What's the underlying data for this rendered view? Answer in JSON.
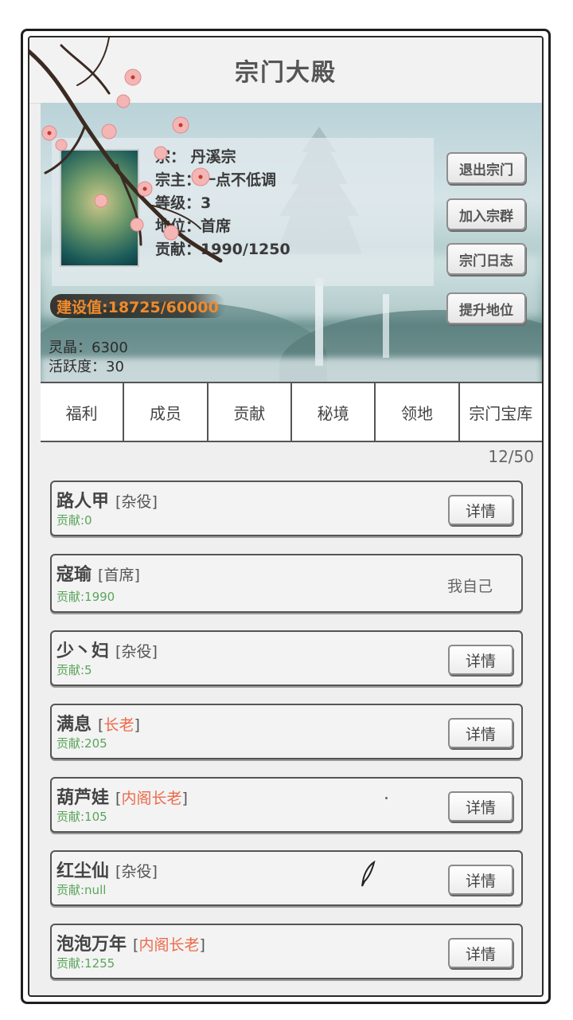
{
  "header": {
    "title": "宗门大殿"
  },
  "sect_info": {
    "name_line": "宗：  丹溪宗",
    "master_line": "宗主：一点不低调",
    "level_line": "等级：3",
    "position_line": "地位：首席",
    "contribution_line": "贡献：1990/1250",
    "construction": "建设值:18725/60000",
    "spirit_crystal": "灵晶：6300",
    "activity": "活跃度：30"
  },
  "actions": {
    "leave": "退出宗门",
    "join_group": "加入宗群",
    "log": "宗门日志",
    "promote": "提升地位"
  },
  "tabs": [
    "福利",
    "成员",
    "贡献",
    "秘境",
    "领地",
    "宗门宝库"
  ],
  "member_count": "12/50",
  "members": [
    {
      "name": "路人甲",
      "rank_open": "[",
      "rank": "杂役",
      "rank_close": "]",
      "contrib": "贡献:0",
      "action": "详情"
    },
    {
      "name": "寇瑜",
      "rank_open": "[",
      "rank": "首席",
      "rank_close": "]",
      "contrib": "贡献:1990",
      "action": "我自己"
    },
    {
      "name": "少丶妇",
      "rank_open": "[",
      "rank": "杂役",
      "rank_close": "]",
      "contrib": "贡献:5",
      "action": "详情"
    },
    {
      "name": "满息",
      "rank_open": "[",
      "rank": "长老",
      "rank_close": "]",
      "contrib": "贡献:205",
      "action": "详情"
    },
    {
      "name": "葫芦娃",
      "rank_open": "[",
      "rank": "内阁长老",
      "rank_close": "]",
      "contrib": "贡献:105",
      "action": "详情"
    },
    {
      "name": "红尘仙",
      "rank_open": "[",
      "rank": "杂役",
      "rank_close": "]",
      "contrib": "贡献:null",
      "action": "详情"
    },
    {
      "name": "泡泡万年",
      "rank_open": "[",
      "rank": "内阁长老",
      "rank_close": "]",
      "contrib": "贡献:1255",
      "action": "详情"
    }
  ],
  "colors": {
    "rank_highlight": "#ec6a4a",
    "contribution": "#5aa55a",
    "construction": "#f08a2c"
  }
}
